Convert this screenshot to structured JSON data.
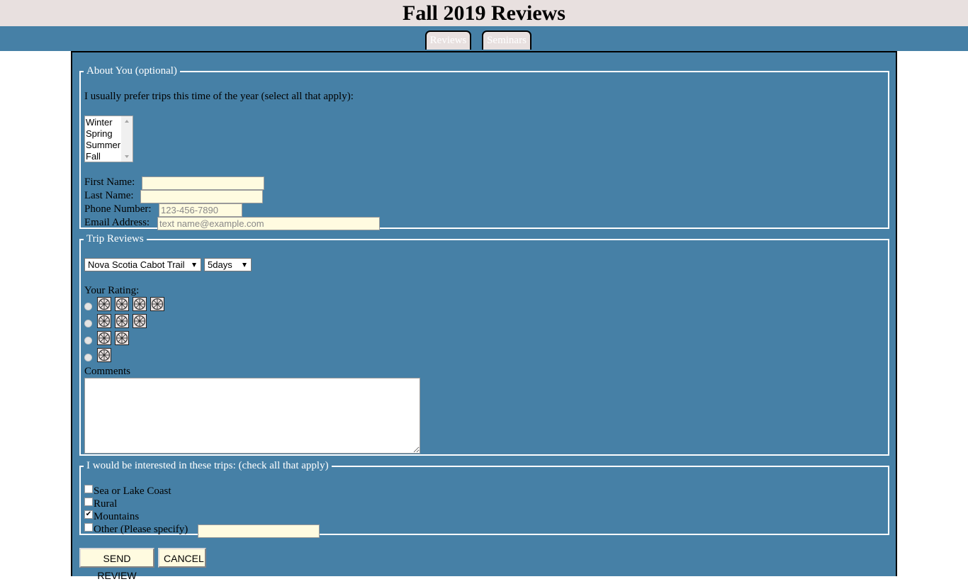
{
  "header": {
    "title": "Fall 2019 Reviews"
  },
  "nav": {
    "tabs": [
      "Reviews",
      "Seminars"
    ]
  },
  "about": {
    "legend": "About You (optional)",
    "prefer_prompt": "I usually prefer trips this time of the year (select all that apply):",
    "seasons": [
      "Winter",
      "Spring",
      "Summer",
      "Fall"
    ],
    "first_name_label": "First Name:",
    "last_name_label": "Last Name:",
    "phone_label": "Phone Number:",
    "phone_placeholder": "123-456-7890",
    "email_label": "Email Address:",
    "email_placeholder": "text name@example.com"
  },
  "trip": {
    "legend": "Trip Reviews",
    "trip_selected": "Nova Scotia Cabot Trail",
    "duration_selected": "5days",
    "rating_label": "Your Rating:",
    "rating_options": [
      4,
      3,
      2,
      1
    ],
    "rating_icon": "wheel-icon",
    "comments_label": "Comments"
  },
  "interests": {
    "legend": "I would be interested in these trips: (check all that apply)",
    "options": [
      {
        "label": "Sea or Lake Coast",
        "checked": false
      },
      {
        "label": "Rural",
        "checked": false
      },
      {
        "label": "Mountains",
        "checked": true
      },
      {
        "label": "Other (Please specify)",
        "checked": false
      }
    ]
  },
  "actions": {
    "send_label": "SEND REVIEW",
    "cancel_label": "CANCEL"
  },
  "colors": {
    "band": "#4680a6",
    "header_bg": "#e8e0df",
    "field_bg": "#fffbe0"
  }
}
